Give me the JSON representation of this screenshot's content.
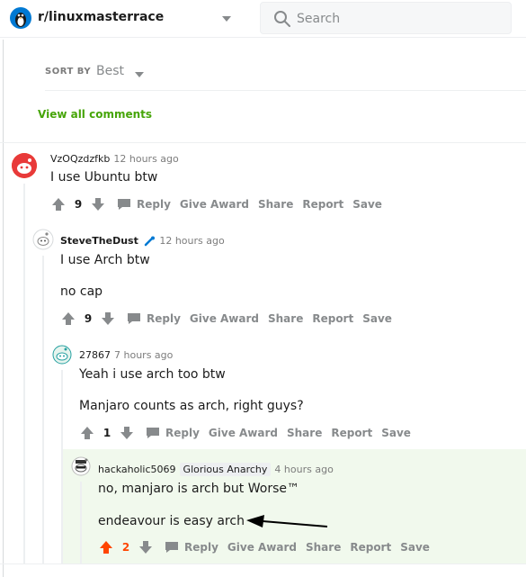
{
  "header": {
    "subreddit": "r/linuxmasterrace",
    "search_placeholder": "Search"
  },
  "sort": {
    "label": "SORT BY",
    "value": "Best"
  },
  "view_all": "View all comments",
  "colors": {
    "accent_green": "#46a508",
    "upvote_active": "#ff4500",
    "highlight_bg": "#f1f9ed"
  },
  "comments": [
    {
      "author": "VzOQzdzfkb",
      "time": "12 hours ago",
      "lines": [
        "I use Ubuntu btw"
      ],
      "score": "9",
      "actions": [
        "Reply",
        "Give Award",
        "Share",
        "Report",
        "Save"
      ]
    },
    {
      "author": "SteveTheDust",
      "time": "12 hours ago",
      "lines": [
        "I use Arch btw",
        "no cap"
      ],
      "score": "9",
      "actions": [
        "Reply",
        "Give Award",
        "Share",
        "Report",
        "Save"
      ]
    },
    {
      "author": "27867",
      "time": "7 hours ago",
      "lines": [
        "Yeah i use arch too btw",
        "Manjaro counts as arch, right guys?"
      ],
      "score": "1",
      "actions": [
        "Reply",
        "Give Award",
        "Share",
        "Report",
        "Save"
      ]
    },
    {
      "author": "hackaholic5069",
      "flair": "Glorious Anarchy",
      "time": "4 hours ago",
      "lines": [
        "no, manjaro is arch but Worse™",
        "endeavour is easy arch"
      ],
      "score": "2",
      "actions": [
        "Reply",
        "Give Award",
        "Share",
        "Report",
        "Save"
      ]
    }
  ]
}
